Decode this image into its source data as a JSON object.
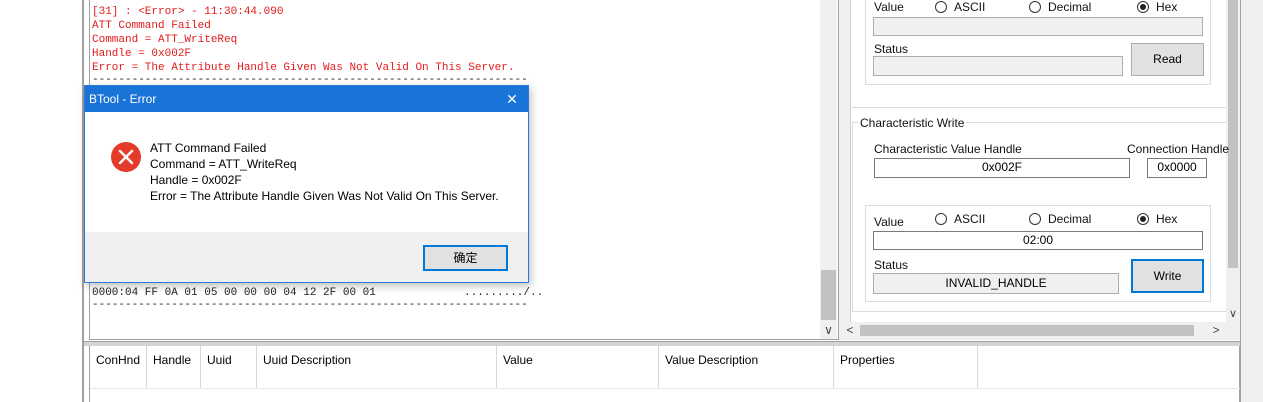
{
  "log": {
    "header": "[31] : <Error> - 11:30:44.090",
    "lines": [
      "ATT Command Failed",
      "Command = ATT_WriteReq",
      "Handle = 0x002F",
      "Error = The Attribute Handle Given Was Not Valid On This Server."
    ],
    "separator": "------------------------------------------------------------------",
    "hex_line": "0000:04 FF 0A 01 05 00 00 00 04 12 2F 00 01",
    "ascii_line": "........./.."
  },
  "dialog": {
    "title": "BTool - Error",
    "close_glyph": "✕",
    "lines": [
      "ATT Command Failed",
      "Command = ATT_WriteReq",
      "Handle = 0x002F",
      "Error = The Attribute Handle Given Was Not Valid On This Server."
    ],
    "ok_label": "确定"
  },
  "read_section": {
    "value_label": "Value",
    "options": [
      "ASCII",
      "Decimal",
      "Hex"
    ],
    "selected": "Hex",
    "value": "",
    "status_label": "Status",
    "status": "",
    "read_label": "Read"
  },
  "write_section": {
    "title": "Characteristic Write",
    "handle_label": "Characteristic Value Handle",
    "handle_value": "0x002F",
    "conn_label": "Connection Handle",
    "conn_value": "0x0000",
    "value_label": "Value",
    "options": [
      "ASCII",
      "Decimal",
      "Hex"
    ],
    "selected": "Hex",
    "value": "02:00",
    "status_label": "Status",
    "status": "INVALID_HANDLE",
    "write_label": "Write"
  },
  "table": {
    "columns": [
      "ConHnd",
      "Handle",
      "Uuid",
      "Uuid Description",
      "Value",
      "Value Description",
      "Properties"
    ]
  },
  "scroll": {
    "down_glyph": "∨",
    "left_glyph": "<",
    "right_glyph": ">"
  },
  "colors": {
    "log_error_text": "#e41b1b",
    "dialog_error_icon": "#e53b2b",
    "button_focus_border": "#0078d7"
  }
}
